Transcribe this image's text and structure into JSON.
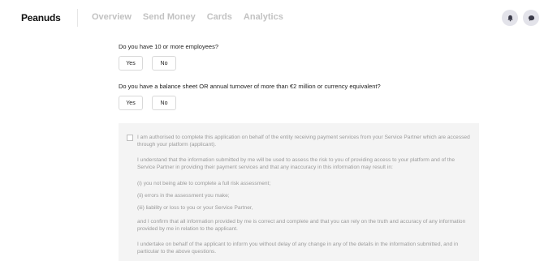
{
  "header": {
    "logo": "Peanuds",
    "nav": [
      "Overview",
      "Send Money",
      "Cards",
      "Analytics"
    ],
    "icons": [
      "bell-icon",
      "chat-icon"
    ]
  },
  "questions": [
    {
      "text": "Do you have 10 or more employees?",
      "yes": "Yes",
      "no": "No"
    },
    {
      "text": "Do you have a balance sheet OR annual turnover of more than €2 million or currency equivalent?",
      "yes": "Yes",
      "no": "No"
    }
  ],
  "consent": {
    "checked": false,
    "paragraphs": [
      "I am authorised to complete this application on behalf of the entity receiving payment services from your Service Partner which are accessed through your platform (applicant).",
      "I understand that the information submitted by me will be used to assess the risk to you of providing access to your platform and of the Service Partner in providing their payment services and that any inaccuracy in this information may result in:",
      "(i) you not being able to complete a full risk assessment;",
      "(ii) errors in the assessment you make;",
      "(iii) liability or loss to you or your Service Partner,",
      "and I confirm that all information provided by me is correct and complete and that you can rely on the truth and accuracy of any information provided by me in relation to the applicant.",
      "I undertake on behalf of the applicant to inform you without delay of any change in any of the details in the information submitted, and in particular to the above questions."
    ]
  },
  "colors": {
    "nav_text": "#c2c2c2",
    "consent_bg": "#f4f4f4",
    "consent_text": "#9a9a9a",
    "icon_bg": "#e3e3ea"
  }
}
